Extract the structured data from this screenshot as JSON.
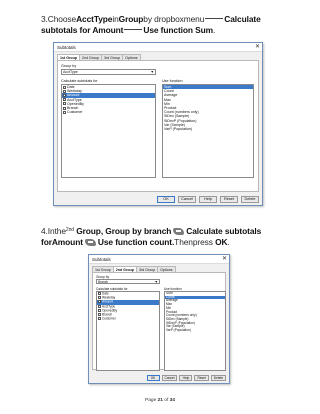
{
  "step3": {
    "pre": "3.Choose",
    "b1": "AcctType",
    "t1": "in",
    "b2": "Group",
    "t2": "by dropboxmenu",
    "b3": "Calculate subtotals for Amount",
    "b4": "Use function Sum",
    "end": "."
  },
  "step4": {
    "pre": "4.Inthe",
    "sup": "2nd",
    "b1": "Group,",
    "t1": "Group by branch",
    "b2": "Calculate subtotals",
    "b3": "forAmount",
    "b4": "Use function count.",
    "t2": "Thenpress",
    "b5": "OK",
    "end": "."
  },
  "dialog1": {
    "title": "Subtotals",
    "close": "✕",
    "tabs": [
      "1st Group",
      "2nd Group",
      "3rd Group",
      "Options"
    ],
    "group_by_label": "Group by",
    "group_by_value": "AcctType",
    "calc_label": "Calculate subtotals for",
    "use_label": "Use function",
    "fields": [
      "Date",
      "Weekday",
      "Amount",
      "AcctType",
      "OpenedBy",
      "Branch",
      "Customer"
    ],
    "functions": [
      "Sum",
      "Count",
      "Average",
      "Max",
      "Min",
      "Product",
      "Count (numbers only)",
      "StDev (Sample)",
      "StDevP (Population)",
      "Var (Sample)",
      "VarP (Population)"
    ],
    "buttons": [
      "OK",
      "Cancel",
      "Help",
      "Reset",
      "Delete"
    ]
  },
  "dialog2": {
    "title": "Subtotals",
    "close": "✕",
    "tabs": [
      "1st Group",
      "2nd Group",
      "3rd Group",
      "Options"
    ],
    "group_by_label": "Group by",
    "group_by_value": "Branch",
    "calc_label": "Calculate subtotals for",
    "use_label": "Use function",
    "fields": [
      "Date",
      "Weekday",
      "Amount",
      "AcctType",
      "OpenedBy",
      "Branch",
      "Customer"
    ],
    "functions": [
      "Sum",
      "Count",
      "Average",
      "Max",
      "Min",
      "Product",
      "Count (numbers only)",
      "StDev (Sample)",
      "StDevP (Population)",
      "Var (Sample)",
      "VarP (Population)"
    ],
    "buttons": [
      "OK",
      "Cancel",
      "Help",
      "Reset",
      "Delete"
    ]
  },
  "footer": {
    "pre": "Page ",
    "num": "21",
    "mid": " of ",
    "total": "34"
  }
}
